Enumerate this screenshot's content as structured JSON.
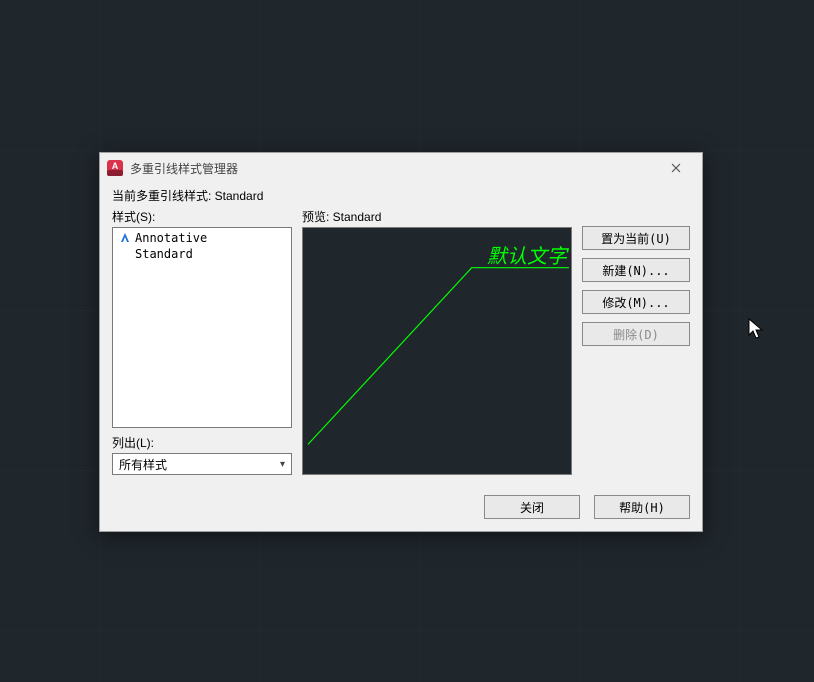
{
  "title": "多重引线样式管理器",
  "current_label_prefix": "当前多重引线样式: ",
  "current_style": "Standard",
  "styles_label": "样式(S):",
  "styles": [
    {
      "name": "Annotative",
      "annotative": true
    },
    {
      "name": "Standard",
      "annotative": false
    }
  ],
  "filter_label": "列出(L):",
  "filter_value": "所有样式",
  "preview_label_prefix": "预览: ",
  "preview_style": "Standard",
  "preview_default_text": "默认文字",
  "buttons": {
    "set_current": "置为当前(U)",
    "new": "新建(N)...",
    "modify": "修改(M)...",
    "delete": "删除(D)",
    "close": "关闭",
    "help": "帮助(H)"
  },
  "colors": {
    "leader": "#00ff00"
  }
}
